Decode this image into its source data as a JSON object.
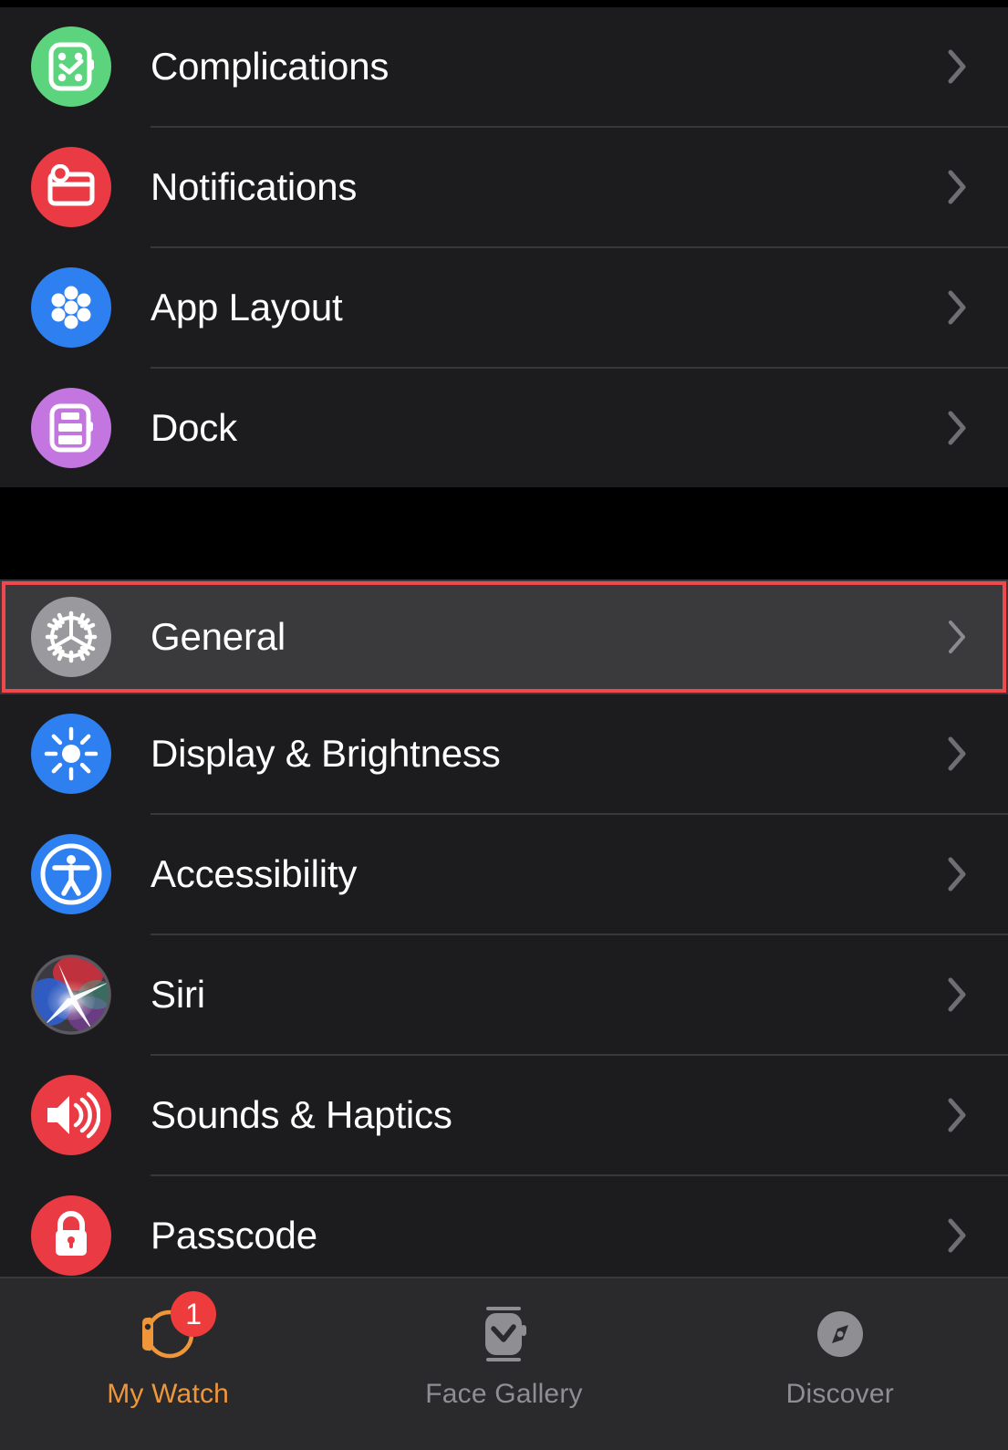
{
  "app": {
    "platform": "watch-settings",
    "accent_active": "#f0963a",
    "accent_inactive": "#8e8e93",
    "highlight_border_color": "#f0484d",
    "highlight_row_bg": "#3a3a3c",
    "row_bg": "#1c1c1e",
    "page_bg": "#000000"
  },
  "sections": [
    {
      "name": "watch-face-section",
      "rows": [
        {
          "label": "Complications",
          "icon": "complications-icon",
          "icon_color": "#5cd47e",
          "accessory": "chevron-right-icon",
          "highlighted": false
        },
        {
          "label": "Notifications",
          "icon": "notifications-icon",
          "icon_color": "#ea3b44",
          "accessory": "chevron-right-icon",
          "highlighted": false
        },
        {
          "label": "App Layout",
          "icon": "app-layout-icon",
          "icon_color": "#2e7fef",
          "accessory": "chevron-right-icon",
          "highlighted": false
        },
        {
          "label": "Dock",
          "icon": "dock-icon",
          "icon_color": "#c376e0",
          "accessory": "chevron-right-icon",
          "highlighted": false
        }
      ]
    },
    {
      "name": "system-settings-section",
      "rows": [
        {
          "label": "General",
          "icon": "gear-icon",
          "icon_color": "#9a9a9e",
          "accessory": "chevron-right-icon",
          "highlighted": true
        },
        {
          "label": "Display & Brightness",
          "icon": "brightness-icon",
          "icon_color": "#2e7fef",
          "accessory": "chevron-right-icon",
          "highlighted": false
        },
        {
          "label": "Accessibility",
          "icon": "accessibility-icon",
          "icon_color": "#2e7fef",
          "accessory": "chevron-right-icon",
          "highlighted": false
        },
        {
          "label": "Siri",
          "icon": "siri-icon",
          "icon_color": "#4a4a50",
          "accessory": "chevron-right-icon",
          "highlighted": false
        },
        {
          "label": "Sounds & Haptics",
          "icon": "sounds-haptics-icon",
          "icon_color": "#ea3b44",
          "accessory": "chevron-right-icon",
          "highlighted": false
        },
        {
          "label": "Passcode",
          "icon": "lock-icon",
          "icon_color": "#ea3b44",
          "accessory": "chevron-right-icon",
          "highlighted": false
        }
      ]
    }
  ],
  "tabbar": {
    "tabs": [
      {
        "label": "My Watch",
        "icon": "watch-icon",
        "active": true,
        "badge": "1"
      },
      {
        "label": "Face Gallery",
        "icon": "watch-face-icon",
        "active": false,
        "badge": null
      },
      {
        "label": "Discover",
        "icon": "compass-icon",
        "active": false,
        "badge": null
      }
    ]
  }
}
